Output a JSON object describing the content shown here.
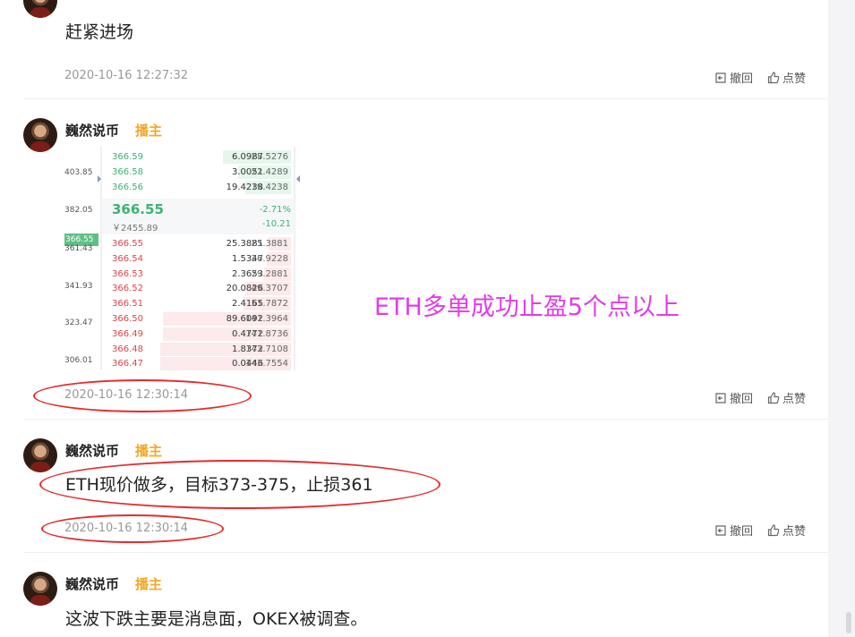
{
  "actions": {
    "retract": "撤回",
    "like": "点赞"
  },
  "posts": [
    {
      "author": "巍然说币",
      "role": "播主",
      "content": "赶紧进场",
      "time": "2020-10-16 12:27:32"
    },
    {
      "author": "巍然说币",
      "role": "播主",
      "time": "2020-10-16 12:30:14",
      "annotation": "ETH多单成功止盈5个点以上"
    },
    {
      "author": "巍然说币",
      "role": "播主",
      "content": "ETH现价做多，目标373-375，止损361",
      "time": "2020-10-16 12:30:14"
    },
    {
      "author": "巍然说币",
      "role": "播主",
      "content": "这波下跌主要是消息面，OKEX被调查。"
    }
  ],
  "orderbook": {
    "axis_ticks": [
      "403.85",
      "382.05",
      "361.43",
      "341.93",
      "323.47",
      "306.01"
    ],
    "axis_marker": "366.55",
    "asks": [
      {
        "price": "366.59",
        "qty": "6.0987",
        "total": "28.5276",
        "depth": 0.36
      },
      {
        "price": "366.58",
        "qty": "3.0051",
        "total": "22.4289",
        "depth": 0.28
      },
      {
        "price": "366.56",
        "qty": "19.4238",
        "total": "19.4238",
        "depth": 0.24
      }
    ],
    "mid": {
      "price": "366.55",
      "cny": "￥2455.89",
      "pct": "-2.71%",
      "change": "-10.21"
    },
    "bids": [
      {
        "price": "366.55",
        "qty": "25.3881",
        "total": "25.3881",
        "depth": 0.12
      },
      {
        "price": "366.54",
        "qty": "1.5347",
        "total": "26.9228",
        "depth": 0.13
      },
      {
        "price": "366.53",
        "qty": "2.3653",
        "total": "29.2881",
        "depth": 0.14
      },
      {
        "price": "366.52",
        "qty": "20.0826",
        "total": "49.3707",
        "depth": 0.24
      },
      {
        "price": "366.51",
        "qty": "2.4165",
        "total": "51.7872",
        "depth": 0.25
      },
      {
        "price": "366.50",
        "qty": "89.6092",
        "total": "141.3964",
        "depth": 0.68
      },
      {
        "price": "366.49",
        "qty": "0.4772",
        "total": "141.8736",
        "depth": 0.68
      },
      {
        "price": "366.48",
        "qty": "1.8372",
        "total": "143.7108",
        "depth": 0.69
      },
      {
        "price": "366.47",
        "qty": "0.0446",
        "total": "143.7554",
        "depth": 0.69
      }
    ]
  },
  "colors": {
    "role": "#f5a623",
    "annotation": "#e13de6",
    "ellipse": "#e52b2b",
    "ask": "#3cb371",
    "bid": "#e0434b"
  }
}
